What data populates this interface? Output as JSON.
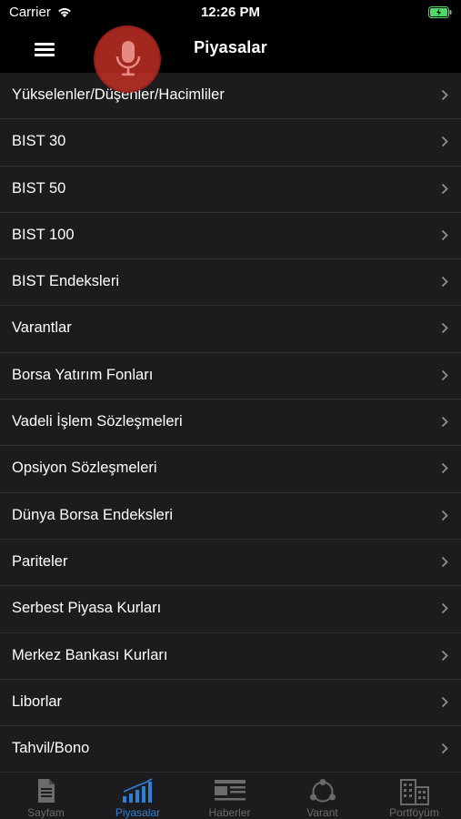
{
  "status_bar": {
    "carrier": "Carrier",
    "time": "12:26 PM"
  },
  "nav": {
    "title": "Piyasalar"
  },
  "list": [
    {
      "label": "Yükselenler/Düşenler/Hacimliler"
    },
    {
      "label": "BIST 30"
    },
    {
      "label": "BIST 50"
    },
    {
      "label": "BIST 100"
    },
    {
      "label": "BIST Endeksleri"
    },
    {
      "label": "Varantlar"
    },
    {
      "label": "Borsa Yatırım Fonları"
    },
    {
      "label": "Vadeli İşlem Sözleşmeleri"
    },
    {
      "label": "Opsiyon Sözleşmeleri"
    },
    {
      "label": "Dünya Borsa Endeksleri"
    },
    {
      "label": "Pariteler"
    },
    {
      "label": "Serbest Piyasa Kurları"
    },
    {
      "label": "Merkez Bankası Kurları"
    },
    {
      "label": "Liborlar"
    },
    {
      "label": "Tahvil/Bono"
    }
  ],
  "tabs": [
    {
      "label": "Sayfam",
      "icon": "document-icon"
    },
    {
      "label": "Piyasalar",
      "icon": "bar-chart-icon",
      "active": true
    },
    {
      "label": "Haberler",
      "icon": "news-icon"
    },
    {
      "label": "Varant",
      "icon": "share-icon"
    },
    {
      "label": "Portföyüm",
      "icon": "buildings-icon"
    }
  ],
  "colors": {
    "accent": "#2f7fd4",
    "background": "#1c1c1e",
    "mic": "#c43026"
  }
}
